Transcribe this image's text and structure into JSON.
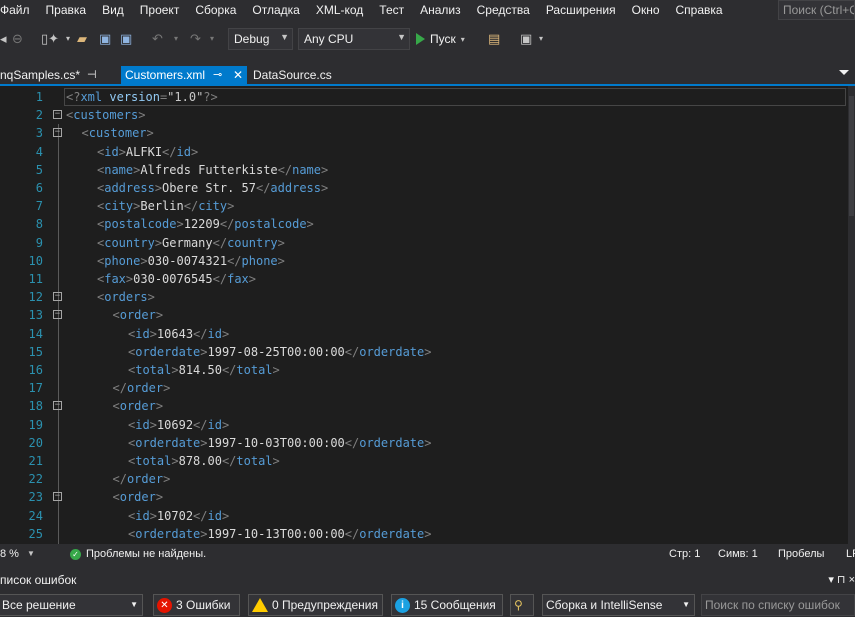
{
  "menu": {
    "items": [
      "Файл",
      "Правка",
      "Вид",
      "Проект",
      "Сборка",
      "Отладка",
      "XML-код",
      "Тест",
      "Анализ",
      "Средства",
      "Расширения",
      "Окно",
      "Справка"
    ],
    "quick_search_placeholder": "Поиск (Ctrl+Q)"
  },
  "toolbar": {
    "config": "Debug",
    "platform": "Any CPU",
    "run_label": "Пуск"
  },
  "tabs": [
    {
      "label": "nqSamples.cs*",
      "active": false
    },
    {
      "label": "Customers.xml",
      "active": true
    },
    {
      "label": "DataSource.cs",
      "active": false
    }
  ],
  "editor": {
    "lines": [
      {
        "n": "1",
        "fold": "",
        "indent": 0,
        "parts": [
          [
            "d",
            "<?"
          ],
          [
            "e",
            "xml"
          ],
          [
            "a",
            " version"
          ],
          [
            "d",
            "="
          ],
          [
            "s",
            "\"1.0\""
          ],
          [
            "d",
            "?>"
          ]
        ]
      },
      {
        "n": "2",
        "fold": "−",
        "indent": 0,
        "parts": [
          [
            "d",
            "<"
          ],
          [
            "e",
            "customers"
          ],
          [
            "d",
            ">"
          ]
        ]
      },
      {
        "n": "3",
        "fold": "−",
        "indent": 1,
        "parts": [
          [
            "d",
            "<"
          ],
          [
            "e",
            "customer"
          ],
          [
            "d",
            ">"
          ]
        ]
      },
      {
        "n": "4",
        "fold": "",
        "indent": 2,
        "parts": [
          [
            "d",
            "<"
          ],
          [
            "e",
            "id"
          ],
          [
            "d",
            ">"
          ],
          [
            "x",
            "ALFKI"
          ],
          [
            "d",
            "</"
          ],
          [
            "e",
            "id"
          ],
          [
            "d",
            ">"
          ]
        ]
      },
      {
        "n": "5",
        "fold": "",
        "indent": 2,
        "parts": [
          [
            "d",
            "<"
          ],
          [
            "e",
            "name"
          ],
          [
            "d",
            ">"
          ],
          [
            "x",
            "Alfreds Futterkiste"
          ],
          [
            "d",
            "</"
          ],
          [
            "e",
            "name"
          ],
          [
            "d",
            ">"
          ]
        ]
      },
      {
        "n": "6",
        "fold": "",
        "indent": 2,
        "parts": [
          [
            "d",
            "<"
          ],
          [
            "e",
            "address"
          ],
          [
            "d",
            ">"
          ],
          [
            "x",
            "Obere Str. 57"
          ],
          [
            "d",
            "</"
          ],
          [
            "e",
            "address"
          ],
          [
            "d",
            ">"
          ]
        ]
      },
      {
        "n": "7",
        "fold": "",
        "indent": 2,
        "parts": [
          [
            "d",
            "<"
          ],
          [
            "e",
            "city"
          ],
          [
            "d",
            ">"
          ],
          [
            "x",
            "Berlin"
          ],
          [
            "d",
            "</"
          ],
          [
            "e",
            "city"
          ],
          [
            "d",
            ">"
          ]
        ]
      },
      {
        "n": "8",
        "fold": "",
        "indent": 2,
        "parts": [
          [
            "d",
            "<"
          ],
          [
            "e",
            "postalcode"
          ],
          [
            "d",
            ">"
          ],
          [
            "x",
            "12209"
          ],
          [
            "d",
            "</"
          ],
          [
            "e",
            "postalcode"
          ],
          [
            "d",
            ">"
          ]
        ]
      },
      {
        "n": "9",
        "fold": "",
        "indent": 2,
        "parts": [
          [
            "d",
            "<"
          ],
          [
            "e",
            "country"
          ],
          [
            "d",
            ">"
          ],
          [
            "x",
            "Germany"
          ],
          [
            "d",
            "</"
          ],
          [
            "e",
            "country"
          ],
          [
            "d",
            ">"
          ]
        ]
      },
      {
        "n": "10",
        "fold": "",
        "indent": 2,
        "parts": [
          [
            "d",
            "<"
          ],
          [
            "e",
            "phone"
          ],
          [
            "d",
            ">"
          ],
          [
            "x",
            "030-0074321"
          ],
          [
            "d",
            "</"
          ],
          [
            "e",
            "phone"
          ],
          [
            "d",
            ">"
          ]
        ]
      },
      {
        "n": "11",
        "fold": "",
        "indent": 2,
        "parts": [
          [
            "d",
            "<"
          ],
          [
            "e",
            "fax"
          ],
          [
            "d",
            ">"
          ],
          [
            "x",
            "030-0076545"
          ],
          [
            "d",
            "</"
          ],
          [
            "e",
            "fax"
          ],
          [
            "d",
            ">"
          ]
        ]
      },
      {
        "n": "12",
        "fold": "−",
        "indent": 2,
        "parts": [
          [
            "d",
            "<"
          ],
          [
            "e",
            "orders"
          ],
          [
            "d",
            ">"
          ]
        ]
      },
      {
        "n": "13",
        "fold": "−",
        "indent": 3,
        "parts": [
          [
            "d",
            "<"
          ],
          [
            "e",
            "order"
          ],
          [
            "d",
            ">"
          ]
        ]
      },
      {
        "n": "14",
        "fold": "",
        "indent": 4,
        "parts": [
          [
            "d",
            "<"
          ],
          [
            "e",
            "id"
          ],
          [
            "d",
            ">"
          ],
          [
            "x",
            "10643"
          ],
          [
            "d",
            "</"
          ],
          [
            "e",
            "id"
          ],
          [
            "d",
            ">"
          ]
        ]
      },
      {
        "n": "15",
        "fold": "",
        "indent": 4,
        "parts": [
          [
            "d",
            "<"
          ],
          [
            "e",
            "orderdate"
          ],
          [
            "d",
            ">"
          ],
          [
            "x",
            "1997-08-25T00:00:00"
          ],
          [
            "d",
            "</"
          ],
          [
            "e",
            "orderdate"
          ],
          [
            "d",
            ">"
          ]
        ]
      },
      {
        "n": "16",
        "fold": "",
        "indent": 4,
        "parts": [
          [
            "d",
            "<"
          ],
          [
            "e",
            "total"
          ],
          [
            "d",
            ">"
          ],
          [
            "x",
            "814.50"
          ],
          [
            "d",
            "</"
          ],
          [
            "e",
            "total"
          ],
          [
            "d",
            ">"
          ]
        ]
      },
      {
        "n": "17",
        "fold": "",
        "indent": 3,
        "parts": [
          [
            "d",
            "</"
          ],
          [
            "e",
            "order"
          ],
          [
            "d",
            ">"
          ]
        ]
      },
      {
        "n": "18",
        "fold": "−",
        "indent": 3,
        "parts": [
          [
            "d",
            "<"
          ],
          [
            "e",
            "order"
          ],
          [
            "d",
            ">"
          ]
        ]
      },
      {
        "n": "19",
        "fold": "",
        "indent": 4,
        "parts": [
          [
            "d",
            "<"
          ],
          [
            "e",
            "id"
          ],
          [
            "d",
            ">"
          ],
          [
            "x",
            "10692"
          ],
          [
            "d",
            "</"
          ],
          [
            "e",
            "id"
          ],
          [
            "d",
            ">"
          ]
        ]
      },
      {
        "n": "20",
        "fold": "",
        "indent": 4,
        "parts": [
          [
            "d",
            "<"
          ],
          [
            "e",
            "orderdate"
          ],
          [
            "d",
            ">"
          ],
          [
            "x",
            "1997-10-03T00:00:00"
          ],
          [
            "d",
            "</"
          ],
          [
            "e",
            "orderdate"
          ],
          [
            "d",
            ">"
          ]
        ]
      },
      {
        "n": "21",
        "fold": "",
        "indent": 4,
        "parts": [
          [
            "d",
            "<"
          ],
          [
            "e",
            "total"
          ],
          [
            "d",
            ">"
          ],
          [
            "x",
            "878.00"
          ],
          [
            "d",
            "</"
          ],
          [
            "e",
            "total"
          ],
          [
            "d",
            ">"
          ]
        ]
      },
      {
        "n": "22",
        "fold": "",
        "indent": 3,
        "parts": [
          [
            "d",
            "</"
          ],
          [
            "e",
            "order"
          ],
          [
            "d",
            ">"
          ]
        ]
      },
      {
        "n": "23",
        "fold": "−",
        "indent": 3,
        "parts": [
          [
            "d",
            "<"
          ],
          [
            "e",
            "order"
          ],
          [
            "d",
            ">"
          ]
        ]
      },
      {
        "n": "24",
        "fold": "",
        "indent": 4,
        "parts": [
          [
            "d",
            "<"
          ],
          [
            "e",
            "id"
          ],
          [
            "d",
            ">"
          ],
          [
            "x",
            "10702"
          ],
          [
            "d",
            "</"
          ],
          [
            "e",
            "id"
          ],
          [
            "d",
            ">"
          ]
        ]
      },
      {
        "n": "25",
        "fold": "",
        "indent": 4,
        "parts": [
          [
            "d",
            "<"
          ],
          [
            "e",
            "orderdate"
          ],
          [
            "d",
            ">"
          ],
          [
            "x",
            "1997-10-13T00:00:00"
          ],
          [
            "d",
            "</"
          ],
          [
            "e",
            "orderdate"
          ],
          [
            "d",
            ">"
          ]
        ]
      }
    ]
  },
  "status": {
    "zoom": "8 %",
    "issues": "Проблемы не найдены.",
    "line": "Стр: 1",
    "col": "Симв: 1",
    "whitespace": "Пробелы",
    "eol": "LF"
  },
  "error_list": {
    "title": "писок ошибок",
    "controls": "▾ ⊓ ×",
    "scope": "Все решение",
    "errors": "3 Ошибки",
    "warnings": "0 Предупреждения",
    "messages": "15 Сообщения",
    "build_filter": "Сборка и IntelliSense",
    "search_placeholder": "Поиск по списку ошибок"
  },
  "colors": {
    "accent": "#007acc",
    "xml_element": "#569cd6",
    "xml_delimiter": "#808080",
    "line_number": "#2b91af"
  }
}
